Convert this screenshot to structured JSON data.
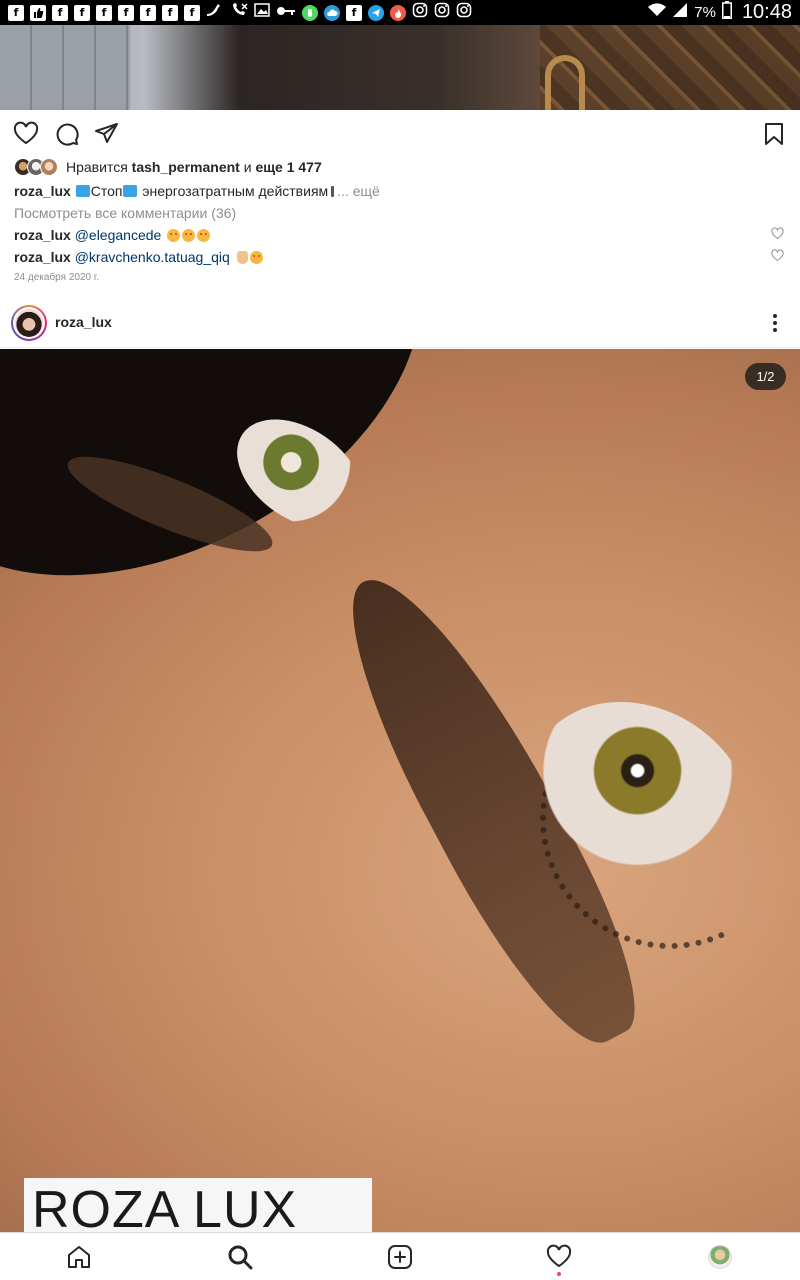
{
  "status_bar": {
    "notification_icons": [
      "f",
      "thumbs-up",
      "f",
      "f",
      "f",
      "f",
      "f",
      "f",
      "f",
      "bird",
      "muted-call",
      "image",
      "key",
      "phone",
      "cloud",
      "f",
      "telegram",
      "fire",
      "instagram",
      "instagram",
      "instagram"
    ],
    "battery": "7%",
    "time": "10:48"
  },
  "previous_post": {
    "likes_prefix": "Нравится",
    "likes_user": "tash_permanent",
    "likes_mid": "и",
    "likes_count": "еще 1 477",
    "caption_user": "roza_lux",
    "caption_text_1": "Стоп",
    "caption_text_2": "энергозатратным действиям",
    "caption_more": "... ещё",
    "view_comments": "Посмотреть все комментарии (36)",
    "comments": [
      {
        "user": "roza_lux",
        "mention": "@elegancede"
      },
      {
        "user": "roza_lux",
        "mention": "@kravchenko.tatuag_qiq"
      }
    ],
    "date": "24 декабря 2020 г."
  },
  "post": {
    "username": "roza_lux",
    "counter": "1/2",
    "logo_text": "ROZA LUX"
  },
  "colors": {
    "text": "#262626",
    "muted": "#8e8e8e",
    "mention": "#003569",
    "notification_dot": "#ed4956"
  },
  "icons": [
    "heart-icon",
    "comment-icon",
    "share-icon",
    "bookmark-icon",
    "more-icon",
    "home-icon",
    "search-icon",
    "add-icon",
    "activity-icon",
    "profile-avatar"
  ]
}
